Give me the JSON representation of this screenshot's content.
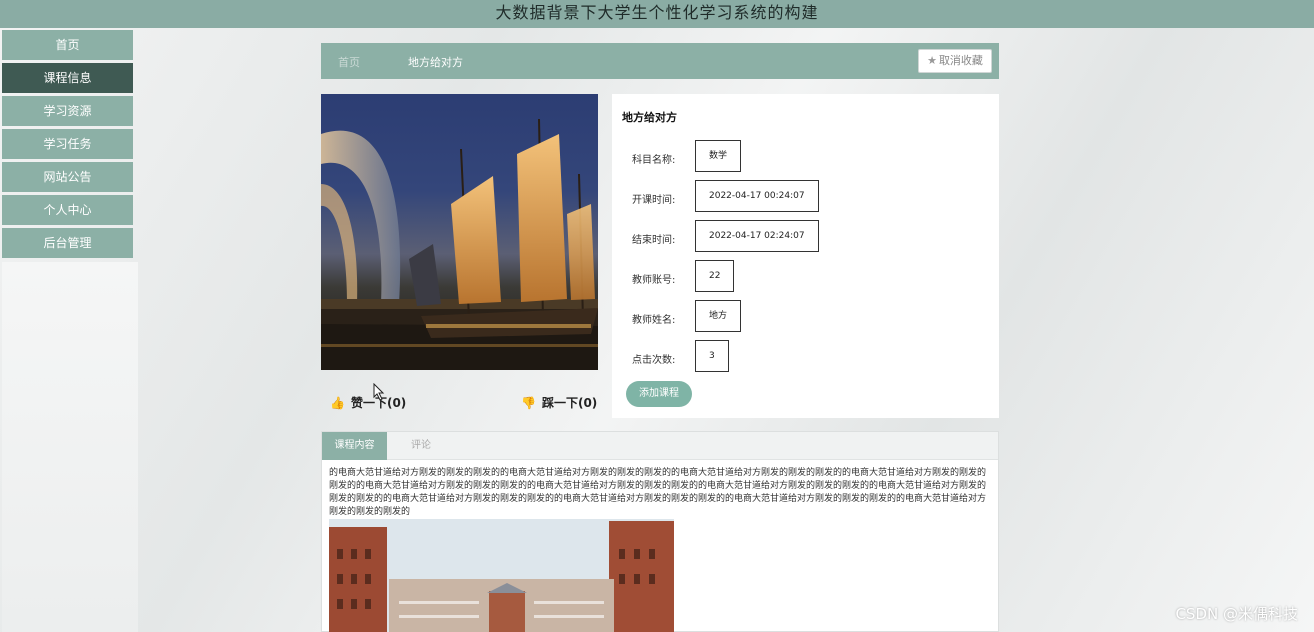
{
  "header": {
    "title": "大数据背景下大学生个性化学习系统的构建"
  },
  "sidebar": {
    "items": [
      {
        "label": "首页"
      },
      {
        "label": "课程信息"
      },
      {
        "label": "学习资源"
      },
      {
        "label": "学习任务"
      },
      {
        "label": "网站公告"
      },
      {
        "label": "个人中心"
      },
      {
        "label": "后台管理"
      }
    ],
    "active_index": 1
  },
  "breadcrumb": {
    "home": "首页",
    "current": "地方给对方"
  },
  "favorite_button": {
    "label": "取消收藏",
    "icon": "star-icon"
  },
  "votes": {
    "like": {
      "label": "赞一下(0)",
      "icon": "thumbs-up-icon"
    },
    "dislike": {
      "label": "踩一下(0)",
      "icon": "thumbs-down-icon"
    }
  },
  "course": {
    "title": "地方给对方",
    "fields": [
      {
        "label": "科目名称:",
        "value": "数学"
      },
      {
        "label": "开课时间:",
        "value": "2022-04-17 00:24:07"
      },
      {
        "label": "结束时间:",
        "value": "2022-04-17 02:24:07"
      },
      {
        "label": "教师账号:",
        "value": "22"
      },
      {
        "label": "教师姓名:",
        "value": "地方"
      },
      {
        "label": "点击次数:",
        "value": "3"
      }
    ],
    "add_button": "添加课程"
  },
  "content_tabs": {
    "active": "课程内容",
    "other": "评论"
  },
  "content_text": "的电商大范甘道给对方刚发的刚发的刚发的的电商大范甘道给对方刚发的刚发的刚发的的电商大范甘道给对方刚发的刚发的刚发的的电商大范甘道给对方刚发的刚发的刚发的的电商大范甘道给对方刚发的刚发的刚发的的电商大范甘道给对方刚发的刚发的刚发的的电商大范甘道给对方刚发的刚发的刚发的的电商大范甘道给对方刚发的刚发的刚发的的电商大范甘道给对方刚发的刚发的刚发的的电商大范甘道给对方刚发的刚发的刚发的的电商大范甘道给对方刚发的刚发的刚发的的电商大范甘道给对方刚发的刚发的刚发的",
  "watermark": "CSDN @米偶科技",
  "colors": {
    "header": "#8aaca4",
    "nav": "#8cb0a6",
    "nav_active": "#3f5a53",
    "add_button": "#7fb4a6",
    "like_icon": "#d23b3b"
  }
}
